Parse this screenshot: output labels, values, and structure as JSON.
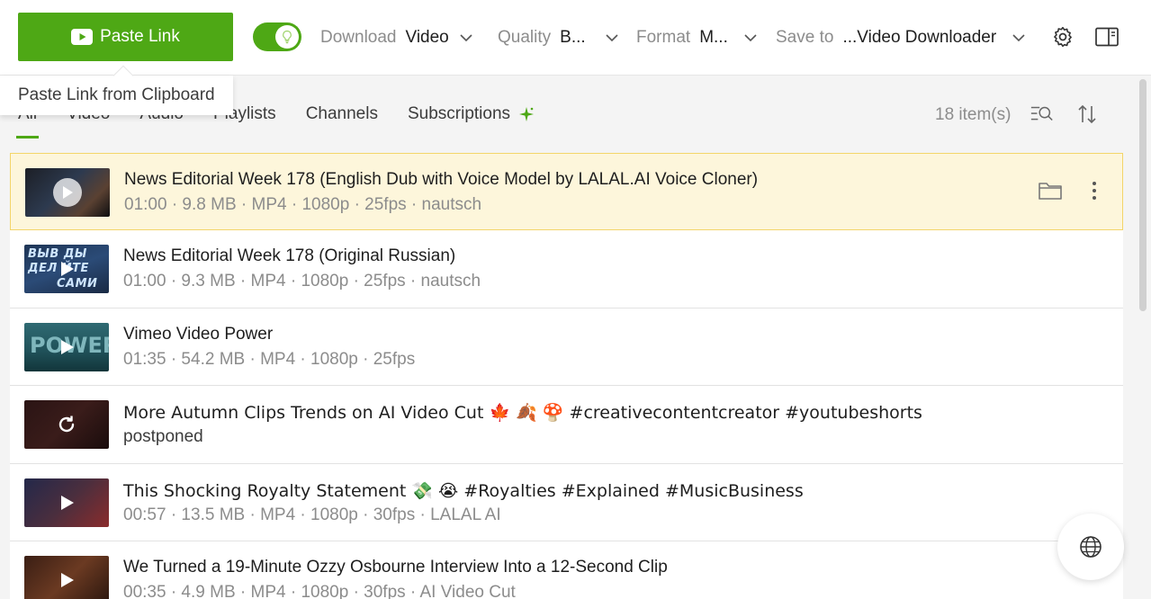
{
  "toolbar": {
    "paste_label": "Paste Link",
    "paste_tooltip": "Paste Link from Clipboard",
    "download": {
      "label": "Download",
      "value": "Video"
    },
    "quality": {
      "label": "Quality",
      "value": "B..."
    },
    "format": {
      "label": "Format",
      "value": "M..."
    },
    "save_to": {
      "label": "Save to",
      "value": "...Video Downloader"
    },
    "smart_mode_on": true
  },
  "tabs": [
    {
      "label": "All",
      "active": true
    },
    {
      "label": "Video"
    },
    {
      "label": "Audio"
    },
    {
      "label": "Playlists"
    },
    {
      "label": "Channels"
    },
    {
      "label": "Subscriptions"
    }
  ],
  "item_count": "18 item(s)",
  "items": [
    {
      "title": "News Editorial Week 178 (English Dub with Voice Model by LALAL.AI Voice Cloner)",
      "meta": "01:00 · 9.8 MB · MP4 · 1080p · 25fps · nautsch",
      "selected": true
    },
    {
      "title": "News Editorial Week 178 (Original Russian)",
      "meta": "01:00 · 9.3 MB · MP4 · 1080p · 25fps · nautsch",
      "thumb_text": [
        "ВЫВ ДЫ",
        "ДЕЛ ЙТЕ",
        "САМИ"
      ]
    },
    {
      "title": "Vimeo   Video Power",
      "meta": "01:35 · 54.2 MB · MP4 · 1080p · 25fps",
      "thumb_text": [
        "POWER"
      ]
    },
    {
      "title": "More Autumn Clips Trends on AI Video Cut 🍁 🍂 🍄 #creativecontentcreator #youtubeshorts",
      "meta": "postponed"
    },
    {
      "title": "This Shocking Royalty Statement 💸 😭 #Royalties #Explained #MusicBusiness",
      "meta": "00:57 · 13.5 MB · MP4 · 1080p · 30fps · LALAL AI"
    },
    {
      "title": "We Turned a 19-Minute Ozzy Osbourne Interview Into a 12-Second Clip",
      "meta": "00:35 · 4.9 MB · MP4 · 1080p · 30fps · AI Video Cut"
    }
  ],
  "colors": {
    "accent": "#4ea815",
    "selected_row": "#fdf6db"
  }
}
